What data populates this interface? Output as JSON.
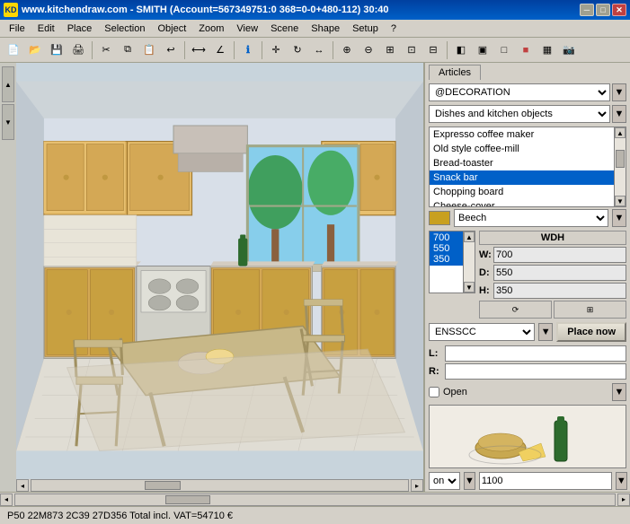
{
  "titlebar": {
    "icon_label": "KD",
    "title": "www.kitchendraw.com - SMITH        (Account=567349751:0  368=0-0+480-112)  30:40",
    "minimize_label": "─",
    "maximize_label": "□",
    "close_label": "✕"
  },
  "menubar": {
    "items": [
      {
        "label": "File"
      },
      {
        "label": "Edit"
      },
      {
        "label": "Place"
      },
      {
        "label": "Selection"
      },
      {
        "label": "Object"
      },
      {
        "label": "Zoom"
      },
      {
        "label": "View"
      },
      {
        "label": "Scene"
      },
      {
        "label": "Shape"
      },
      {
        "label": "Setup"
      },
      {
        "label": "?"
      }
    ]
  },
  "right_panel": {
    "tab_label": "Articles",
    "decoration_label": "@DECORATION",
    "category_label": "Dishes and kitchen objects",
    "articles_list": [
      {
        "label": "Expresso coffee maker",
        "selected": false
      },
      {
        "label": "Old style coffee-mill",
        "selected": false
      },
      {
        "label": "Bread-toaster",
        "selected": false
      },
      {
        "label": "Snack bar",
        "selected": true
      },
      {
        "label": "Chopping board",
        "selected": false
      },
      {
        "label": "Cheese-cover",
        "selected": false
      }
    ],
    "material_color": "#c8a020",
    "material_label": "Beech",
    "dimensions_list": [
      {
        "label": "700  550  350",
        "selected": true
      }
    ],
    "wdh_header": "WDH",
    "wdh_w_label": "W:",
    "wdh_w_value": "700",
    "wdh_d_label": "D:",
    "wdh_d_value": "550",
    "wdh_h_label": "H:",
    "wdh_h_value": "350",
    "ensscc_value": "ENSSCC",
    "place_now_label": "Place now",
    "l_label": "L:",
    "l_value": "",
    "r_label": "R:",
    "r_value": "",
    "open_label": "Open",
    "on_value": "on",
    "number_value": "1100"
  },
  "status_bar": {
    "text": "P50 22M873 2C39 27D356 Total incl. VAT=54710 €"
  }
}
